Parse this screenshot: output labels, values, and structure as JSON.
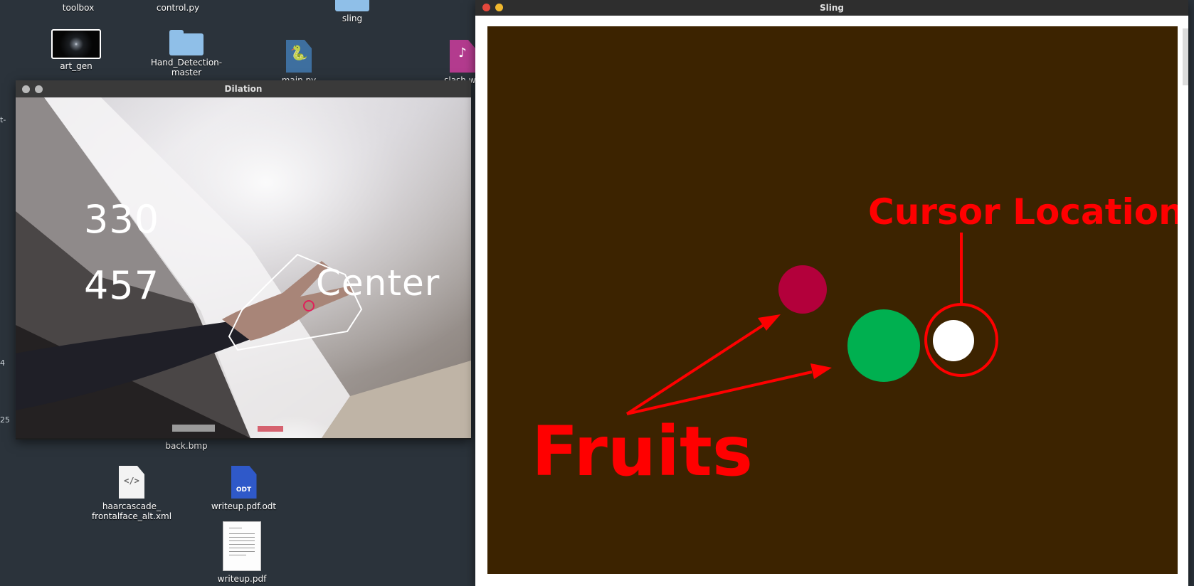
{
  "desktop": {
    "icons": {
      "toolbox": "toolbox",
      "control": "control.py",
      "sling": "sling",
      "art_gen": "art_gen",
      "hand_detection": "Hand_Detection-\nmaster",
      "main_py": "main.py",
      "slash": "slash.wa",
      "back_bmp": "back.bmp",
      "haarcascade": "haarcascade_\nfrontalface_alt.xml",
      "writeup_odt": "writeup.pdf.odt",
      "writeup_pdf": "writeup.pdf"
    },
    "edge_fragments": [
      "t-",
      "4",
      "25"
    ]
  },
  "dilation_window": {
    "title": "Dilation",
    "readout_x": "330",
    "readout_y": "457",
    "center_label": "Center"
  },
  "sling_window": {
    "title": "Sling",
    "annotations": {
      "cursor_label": "Cursor Location",
      "fruits_label": "Fruits"
    },
    "colors": {
      "background": "#3c2300",
      "fruit_red": "#b3003b",
      "fruit_green": "#00b050",
      "cursor": "#ffffff",
      "annotation": "#ff0000"
    }
  },
  "icons": [
    "folder-icon",
    "python-file-icon",
    "music-file-icon",
    "code-file-icon",
    "odt-file-icon",
    "pdf-thumbnail-icon",
    "close-dot-icon",
    "minimize-dot-icon"
  ]
}
